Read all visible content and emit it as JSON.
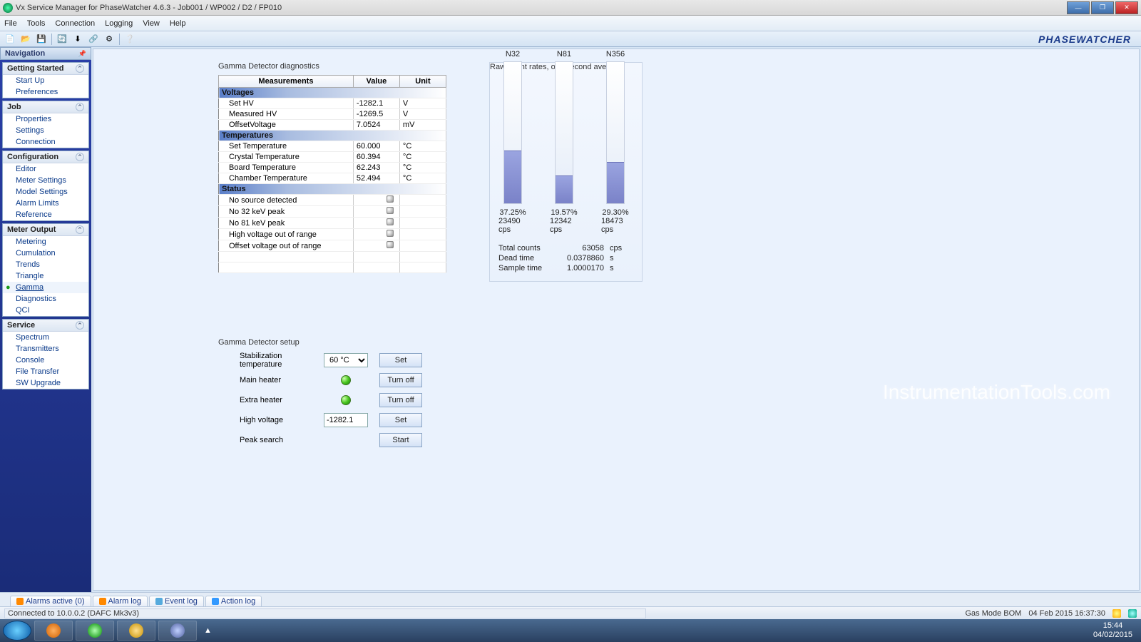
{
  "window": {
    "title": "Vx Service Manager for PhaseWatcher 4.6.3 - Job001 / WP002 / D2 / FP010"
  },
  "menu": {
    "file": "File",
    "tools": "Tools",
    "connection": "Connection",
    "logging": "Logging",
    "view": "View",
    "help": "Help"
  },
  "brand": "PHASEWATCHER",
  "nav": {
    "title": "Navigation",
    "groups": [
      {
        "title": "Getting Started",
        "items": [
          "Start Up",
          "Preferences"
        ]
      },
      {
        "title": "Job",
        "items": [
          "Properties",
          "Settings",
          "Connection"
        ]
      },
      {
        "title": "Configuration",
        "items": [
          "Editor",
          "Meter Settings",
          "Model Settings",
          "Alarm Limits",
          "Reference"
        ]
      },
      {
        "title": "Meter Output",
        "items": [
          "Metering",
          "Cumulation",
          "Trends",
          "Triangle",
          "Gamma",
          "Diagnostics",
          "QCI"
        ],
        "active": "Gamma"
      },
      {
        "title": "Service",
        "items": [
          "Spectrum",
          "Transmitters",
          "Console",
          "File Transfer",
          "SW Upgrade"
        ]
      }
    ]
  },
  "diag": {
    "title": "Gamma Detector diagnostics",
    "headers": {
      "m": "Measurements",
      "v": "Value",
      "u": "Unit"
    },
    "sections": [
      {
        "name": "Voltages",
        "rows": [
          {
            "m": "Set HV",
            "v": "-1282.1",
            "u": "V"
          },
          {
            "m": "Measured HV",
            "v": "-1269.5",
            "u": "V"
          },
          {
            "m": "OffsetVoltage",
            "v": "7.0524",
            "u": "mV"
          }
        ]
      },
      {
        "name": "Temperatures",
        "rows": [
          {
            "m": "Set Temperature",
            "v": "60.000",
            "u": "°C"
          },
          {
            "m": "Crystal Temperature",
            "v": "60.394",
            "u": "°C"
          },
          {
            "m": "Board Temperature",
            "v": "62.243",
            "u": "°C"
          },
          {
            "m": "Chamber Temperature",
            "v": "52.494",
            "u": "°C"
          }
        ]
      },
      {
        "name": "Status",
        "rows": [
          {
            "m": "No source detected",
            "led": true
          },
          {
            "m": "No 32 keV peak",
            "led": true
          },
          {
            "m": "No 81 keV peak",
            "led": true
          },
          {
            "m": "High voltage out of range",
            "led": true
          },
          {
            "m": "Offset voltage out of range",
            "led": true
          }
        ]
      }
    ]
  },
  "rates": {
    "title": "Raw count rates, one second average",
    "bars": [
      {
        "name": "N32",
        "pct": "37.25%",
        "cps": "23490 cps",
        "fill": 37.25
      },
      {
        "name": "N81",
        "pct": "19.57%",
        "cps": "12342 cps",
        "fill": 19.57
      },
      {
        "name": "N356",
        "pct": "29.30%",
        "cps": "18473 cps",
        "fill": 29.3
      }
    ],
    "summary": [
      {
        "k": "Total counts",
        "v": "63058",
        "u": "cps"
      },
      {
        "k": "Dead time",
        "v": "0.0378860",
        "u": "s"
      },
      {
        "k": "Sample time",
        "v": "1.0000170",
        "u": "s"
      }
    ]
  },
  "setup": {
    "title": "Gamma Detector setup",
    "stab_label": "Stabilization temperature",
    "stab_value": "60 °C",
    "stab_btn": "Set",
    "main_label": "Main heater",
    "main_btn": "Turn off",
    "extra_label": "Extra heater",
    "extra_btn": "Turn off",
    "hv_label": "High voltage",
    "hv_value": "-1282.1",
    "hv_btn": "Set",
    "peak_label": "Peak search",
    "peak_btn": "Start"
  },
  "watermark": "InstrumentationTools.com",
  "bottom_tabs": {
    "a1": "Alarms active (0)",
    "a2": "Alarm log",
    "a3": "Event log",
    "a4": "Action log"
  },
  "status": {
    "conn": "Connected to 10.0.0.2 (DAFC Mk3v3)",
    "mode": "Gas Mode  BOM",
    "time": "04 Feb 2015 16:37:30"
  },
  "taskbar": {
    "time": "15:44",
    "date": "04/02/2015"
  },
  "chart_data": {
    "type": "bar",
    "title": "Raw count rates, one second average",
    "categories": [
      "N32",
      "N81",
      "N356"
    ],
    "series": [
      {
        "name": "Percent",
        "values": [
          37.25,
          19.57,
          29.3
        ],
        "unit": "%"
      },
      {
        "name": "Count rate",
        "values": [
          23490,
          12342,
          18473
        ],
        "unit": "cps"
      }
    ],
    "ylim": [
      0,
      100
    ],
    "summary": {
      "total_counts_cps": 63058,
      "dead_time_s": 0.037886,
      "sample_time_s": 1.000017
    }
  }
}
